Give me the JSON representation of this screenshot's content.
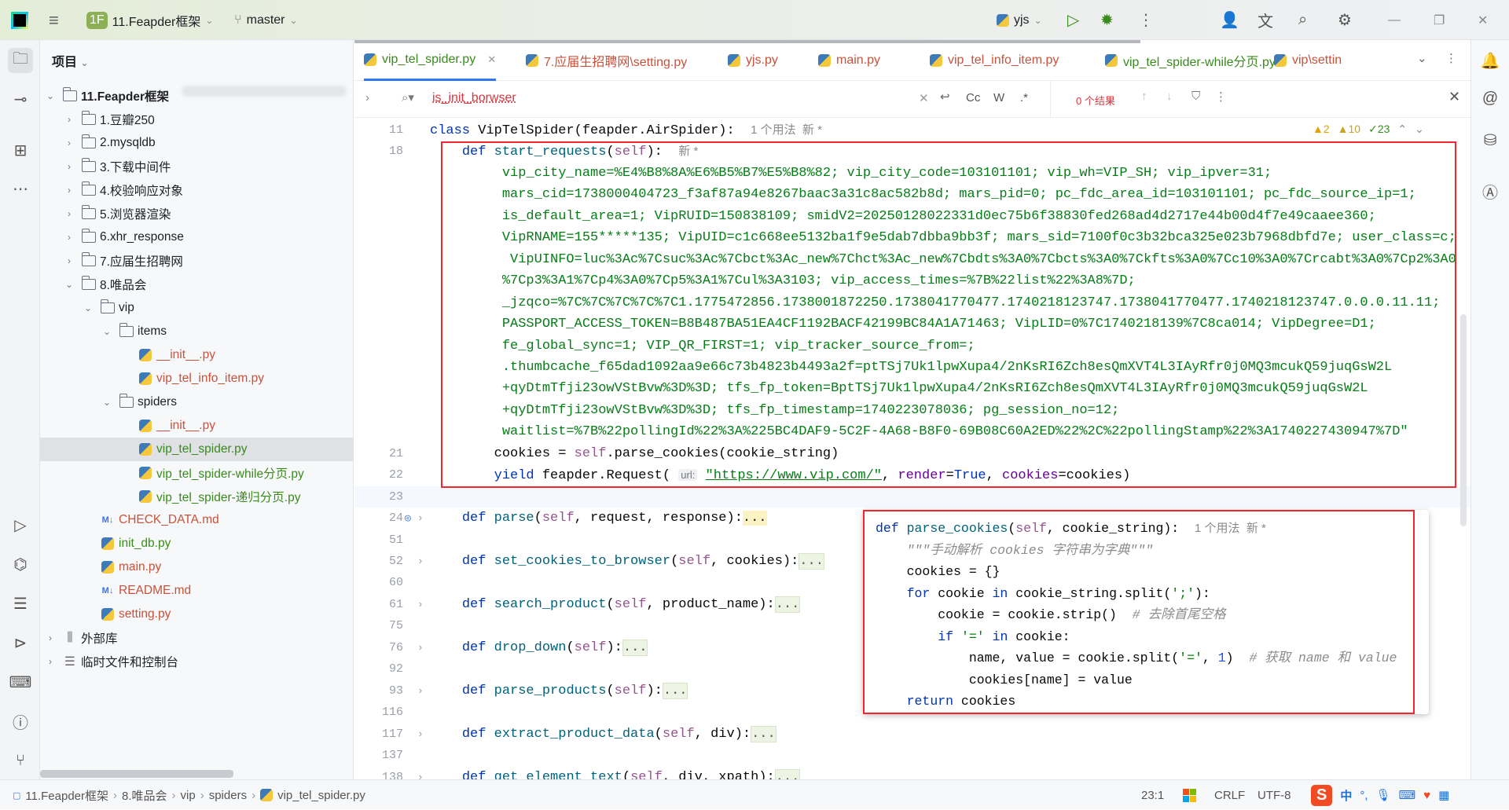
{
  "titlebar": {
    "project_badge": "1F",
    "project_name": "11.Feapder框架",
    "branch": "master",
    "run_config": "yjs"
  },
  "colors": {
    "accent": "#3574f0",
    "highlight_box": "#f2262f",
    "keyword": "#0033b3",
    "string": "#067d17",
    "modified_file": "#c7523b",
    "new_file": "#3a8a1e"
  },
  "project": {
    "title": "项目",
    "tree": [
      {
        "label": "11.Feapder框架",
        "depth": 0,
        "type": "folder",
        "open": true,
        "bold": true
      },
      {
        "label": "1.豆瓣250",
        "depth": 1,
        "type": "folder",
        "open": false
      },
      {
        "label": "2.mysqldb",
        "depth": 1,
        "type": "folder",
        "open": false
      },
      {
        "label": "3.下载中间件",
        "depth": 1,
        "type": "folder",
        "open": false
      },
      {
        "label": "4.校验响应对象",
        "depth": 1,
        "type": "folder",
        "open": false
      },
      {
        "label": "5.浏览器渲染",
        "depth": 1,
        "type": "folder",
        "open": false
      },
      {
        "label": "6.xhr_response",
        "depth": 1,
        "type": "folder",
        "open": false
      },
      {
        "label": "7.应届生招聘网",
        "depth": 1,
        "type": "folder",
        "open": false
      },
      {
        "label": "8.唯品会",
        "depth": 1,
        "type": "folder",
        "open": true
      },
      {
        "label": "vip",
        "depth": 2,
        "type": "folder",
        "open": true
      },
      {
        "label": "items",
        "depth": 3,
        "type": "folder",
        "open": true
      },
      {
        "label": "__init__.py",
        "depth": 4,
        "type": "py",
        "status": "modified"
      },
      {
        "label": "vip_tel_info_item.py",
        "depth": 4,
        "type": "py",
        "status": "modified"
      },
      {
        "label": "spiders",
        "depth": 3,
        "type": "folder",
        "open": true
      },
      {
        "label": "__init__.py",
        "depth": 4,
        "type": "py",
        "status": "modified"
      },
      {
        "label": "vip_tel_spider.py",
        "depth": 4,
        "type": "py",
        "status": "new",
        "selected": true
      },
      {
        "label": "vip_tel_spider-while分页.py",
        "depth": 4,
        "type": "py",
        "status": "new"
      },
      {
        "label": "vip_tel_spider-递归分页.py",
        "depth": 4,
        "type": "py",
        "status": "new"
      },
      {
        "label": "CHECK_DATA.md",
        "depth": 2,
        "type": "md",
        "status": "modified"
      },
      {
        "label": "init_db.py",
        "depth": 2,
        "type": "py",
        "status": "new"
      },
      {
        "label": "main.py",
        "depth": 2,
        "type": "py",
        "status": "modified"
      },
      {
        "label": "README.md",
        "depth": 2,
        "type": "md",
        "status": "modified"
      },
      {
        "label": "setting.py",
        "depth": 2,
        "type": "py",
        "status": "modified"
      },
      {
        "label": "外部库",
        "depth": 0,
        "type": "lib",
        "open": false
      },
      {
        "label": "临时文件和控制台",
        "depth": 0,
        "type": "scratch",
        "open": false
      }
    ]
  },
  "tabs": [
    {
      "label": "vip_tel_spider.py",
      "status": "new",
      "active": true
    },
    {
      "label": "7.应届生招聘网\\setting.py",
      "status": "modified"
    },
    {
      "label": "yjs.py",
      "status": "modified"
    },
    {
      "label": "main.py",
      "status": "modified"
    },
    {
      "label": "vip_tel_info_item.py",
      "status": "modified"
    },
    {
      "label": "vip_tel_spider-while分页.py",
      "status": "new"
    },
    {
      "label": "vip\\settin",
      "status": "modified"
    }
  ],
  "search": {
    "query": "is_init_borwser",
    "match_case": "Cc",
    "words": "W",
    "regex": ".*",
    "results": "0 个结果"
  },
  "inspections": {
    "errors": "2",
    "warnings": "10",
    "ok": "23"
  },
  "editor": {
    "lines": [
      {
        "n": "11",
        "t": [
          [
            "kw",
            "class "
          ],
          [
            "pl",
            "VipTelSpider(feapder.AirSpider):  "
          ],
          [
            "hint",
            "1 个用法  新 *"
          ]
        ]
      },
      {
        "n": "18",
        "t": [
          [
            "pl",
            "    "
          ],
          [
            "kw",
            "def "
          ],
          [
            "fn",
            "start_requests"
          ],
          [
            "pl",
            "("
          ],
          [
            "self",
            "self"
          ],
          [
            "pl",
            "):  "
          ],
          [
            "hint",
            "新 *"
          ]
        ]
      },
      {
        "n": "",
        "t": [
          [
            "str",
            "         vip_city_name=%E4%B8%8A%E6%B5%B7%E5%B8%82; vip_city_code=103101101; vip_wh=VIP_SH; vip_ipver=31;"
          ]
        ]
      },
      {
        "n": "",
        "t": [
          [
            "str",
            "         mars_cid=1738000404723_f3af87a94e8267baac3a31c8ac582b8d; mars_pid=0; pc_fdc_area_id=103101101; pc_fdc_source_ip=1;"
          ]
        ]
      },
      {
        "n": "",
        "t": [
          [
            "str",
            "         is_default_area=1; VipRUID=150838109; smidV2=20250128022331d0ec75b6f38830fed268ad4d2717e44b00d4f7e49caaee360;"
          ]
        ]
      },
      {
        "n": "",
        "t": [
          [
            "str",
            "         VipRNAME=155*****135; VipUID=c1c668ee5132ba1f9e5dab7dbba9bb3f; mars_sid=7100f0c3b32bca325e023b7968dbfd7e; user_class=c;"
          ]
        ]
      },
      {
        "n": "",
        "t": [
          [
            "str",
            "          VipUINFO=luc%3Ac%7Csuc%3Ac%7Cbct%3Ac_new%7Chct%3Ac_new%7Cbdts%3A0%7Cbcts%3A0%7Ckfts%3A0%7Cc10%3A0%7Crcabt%3A0%7Cp2%3A0"
          ]
        ]
      },
      {
        "n": "",
        "t": [
          [
            "str",
            "         %7Cp3%3A1%7Cp4%3A0%7Cp5%3A1%7Cul%3A3103; vip_access_times=%7B%22list%22%3A8%7D;"
          ]
        ]
      },
      {
        "n": "",
        "t": [
          [
            "str",
            "         _jzqco=%7C%7C%7C%7C%7C1.1775472856.1738001872250.1738041770477.1740218123747.1738041770477.1740218123747.0.0.0.11.11;"
          ]
        ]
      },
      {
        "n": "",
        "t": [
          [
            "str",
            "         PASSPORT_ACCESS_TOKEN=B8B487BA51EA4CF1192BACF42199BC84A1A71463; VipLID=0%7C1740218139%7C8ca014; VipDegree=D1;"
          ]
        ]
      },
      {
        "n": "",
        "t": [
          [
            "str",
            "         fe_global_sync=1; VIP_QR_FIRST=1; vip_tracker_source_from=;"
          ]
        ]
      },
      {
        "n": "",
        "t": [
          [
            "str",
            "         .thumbcache_f65dad1092aa9e66c73b4823b4493a2f=ptTSj7Uk1lpwXupa4/2nKsRI6Zch8esQmXVT4L3IAyRfr0j0MQ3mcukQ59juqGsW2L"
          ]
        ]
      },
      {
        "n": "",
        "t": [
          [
            "str",
            "         +qyDtmTfji23owVStBvw%3D%3D; tfs_fp_token=BptTSj7Uk1lpwXupa4/2nKsRI6Zch8esQmXVT4L3IAyRfr0j0MQ3mcukQ59juqGsW2L"
          ]
        ]
      },
      {
        "n": "",
        "t": [
          [
            "str",
            "         +qyDtmTfji23owVStBvw%3D%3D; tfs_fp_timestamp=1740223078036; pg_session_no=12;"
          ]
        ]
      },
      {
        "n": "",
        "t": [
          [
            "str",
            "         waitlist=%7B%22pollingId%22%3A%225BC4DAF9-5C2F-4A68-B8F0-69B08C60A2ED%22%2C%22pollingStamp%22%3A1740227430947%7D\""
          ]
        ]
      },
      {
        "n": "21",
        "t": [
          [
            "pl",
            "        cookies = "
          ],
          [
            "self",
            "self"
          ],
          [
            "pl",
            ".parse_cookies(cookie_string)"
          ]
        ]
      },
      {
        "n": "22",
        "t": [
          [
            "pl",
            "        "
          ],
          [
            "kw",
            "yield "
          ],
          [
            "pl",
            "feapder.Request( "
          ],
          [
            "inlay",
            "url:"
          ],
          [
            "pl",
            " "
          ],
          [
            "url",
            "\"https://www.vip.com/\""
          ],
          [
            "pl",
            ", "
          ],
          [
            "prm",
            "render"
          ],
          [
            "pl",
            "="
          ],
          [
            "kw",
            "True"
          ],
          [
            "pl",
            ", "
          ],
          [
            "prm",
            "cookies"
          ],
          [
            "pl",
            "=cookies)"
          ]
        ]
      },
      {
        "n": "23",
        "t": [],
        "current": true
      },
      {
        "n": "24",
        "t": [
          [
            "pl",
            "    "
          ],
          [
            "kw",
            "def "
          ],
          [
            "fn",
            "parse"
          ],
          [
            "pl",
            "("
          ],
          [
            "self",
            "self"
          ],
          [
            "pl",
            ", request, response):"
          ],
          [
            "hl",
            "..."
          ]
        ],
        "fold": true
      },
      {
        "n": "51",
        "t": []
      },
      {
        "n": "52",
        "t": [
          [
            "pl",
            "    "
          ],
          [
            "kw",
            "def "
          ],
          [
            "fn",
            "set_cookies_to_browser"
          ],
          [
            "pl",
            "("
          ],
          [
            "self",
            "self"
          ],
          [
            "pl",
            ", cookies):"
          ],
          [
            "fld",
            "..."
          ]
        ],
        "fold": true
      },
      {
        "n": "60",
        "t": []
      },
      {
        "n": "61",
        "t": [
          [
            "pl",
            "    "
          ],
          [
            "kw",
            "def "
          ],
          [
            "fn",
            "search_product"
          ],
          [
            "pl",
            "("
          ],
          [
            "self",
            "self"
          ],
          [
            "pl",
            ", product_name):"
          ],
          [
            "fld",
            "..."
          ]
        ],
        "fold": true
      },
      {
        "n": "75",
        "t": []
      },
      {
        "n": "76",
        "t": [
          [
            "pl",
            "    "
          ],
          [
            "kw",
            "def "
          ],
          [
            "fn",
            "drop_down"
          ],
          [
            "pl",
            "("
          ],
          [
            "self",
            "self"
          ],
          [
            "pl",
            "):"
          ],
          [
            "fld",
            "..."
          ]
        ],
        "fold": true
      },
      {
        "n": "92",
        "t": []
      },
      {
        "n": "93",
        "t": [
          [
            "pl",
            "    "
          ],
          [
            "kw",
            "def "
          ],
          [
            "fn",
            "parse_products"
          ],
          [
            "pl",
            "("
          ],
          [
            "self",
            "self"
          ],
          [
            "pl",
            "):"
          ],
          [
            "fld",
            "..."
          ]
        ],
        "fold": true
      },
      {
        "n": "116",
        "t": []
      },
      {
        "n": "117",
        "t": [
          [
            "pl",
            "    "
          ],
          [
            "kw",
            "def "
          ],
          [
            "fn",
            "extract_product_data"
          ],
          [
            "pl",
            "("
          ],
          [
            "self",
            "self"
          ],
          [
            "pl",
            ", div):"
          ],
          [
            "fld",
            "..."
          ]
        ],
        "fold": true
      },
      {
        "n": "137",
        "t": []
      },
      {
        "n": "138",
        "t": [
          [
            "pl",
            "    "
          ],
          [
            "kw",
            "def "
          ],
          [
            "fn",
            "get_element_text"
          ],
          [
            "pl",
            "("
          ],
          [
            "self",
            "self"
          ],
          [
            "pl",
            ", div, xpath):"
          ],
          [
            "fld",
            "..."
          ]
        ],
        "fold": true
      }
    ]
  },
  "popup": {
    "lines": [
      [
        [
          "kw",
          "def "
        ],
        [
          "fn",
          "parse_cookies"
        ],
        [
          "pl",
          "("
        ],
        [
          "self",
          "self"
        ],
        [
          "pl",
          ", cookie_string):  "
        ],
        [
          "hint",
          "1 个用法  新 *"
        ]
      ],
      [
        [
          "cm",
          "    \"\"\"手动解析 cookies 字符串为字典\"\"\""
        ]
      ],
      [
        [
          "pl",
          "    cookies = {}"
        ]
      ],
      [
        [
          "pl",
          "    "
        ],
        [
          "kw",
          "for "
        ],
        [
          "pl",
          "cookie "
        ],
        [
          "kw",
          "in "
        ],
        [
          "pl",
          "cookie_string.split("
        ],
        [
          "str",
          "';'"
        ],
        [
          "pl",
          "):"
        ]
      ],
      [
        [
          "pl",
          "        cookie = cookie.strip()  "
        ],
        [
          "cm",
          "# 去除首尾空格"
        ]
      ],
      [
        [
          "pl",
          "        "
        ],
        [
          "kw",
          "if "
        ],
        [
          "str",
          "'='"
        ],
        [
          "kw",
          " in "
        ],
        [
          "pl",
          "cookie:"
        ]
      ],
      [
        [
          "pl",
          "            name, value = cookie.split("
        ],
        [
          "str",
          "'='"
        ],
        [
          "pl",
          ", "
        ],
        [
          "num",
          "1"
        ],
        [
          "pl",
          ")  "
        ],
        [
          "cm",
          "# 获取 name 和 value"
        ]
      ],
      [
        [
          "pl",
          "            cookies[name] = value"
        ]
      ],
      [
        [
          "pl",
          "    "
        ],
        [
          "kw",
          "return "
        ],
        [
          "pl",
          "cookies"
        ]
      ]
    ]
  },
  "statusbar": {
    "breadcrumb": [
      "11.Feapder框架",
      "8.唯品会",
      "vip",
      "spiders",
      "vip_tel_spider.py"
    ],
    "position": "23:1",
    "line_ending": "CRLF",
    "encoding": "UTF-8",
    "ime": "中"
  }
}
